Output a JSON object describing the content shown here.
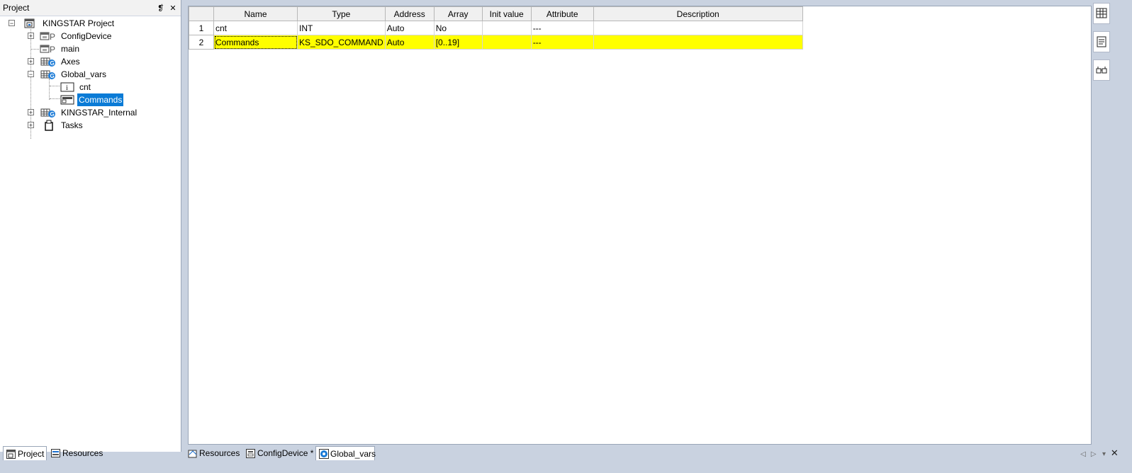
{
  "project_panel": {
    "title": "Project",
    "pin_glyph": "❡",
    "close_glyph": "✕",
    "tree": [
      {
        "label": "KINGSTAR Project",
        "icon": "project-icon",
        "expander": "−"
      },
      {
        "label": "ConfigDevice",
        "icon": "program-icon",
        "expander": "+"
      },
      {
        "label": "main",
        "icon": "program-icon",
        "expander": ""
      },
      {
        "label": "Axes",
        "icon": "global-vars-icon",
        "expander": "+"
      },
      {
        "label": "Global_vars",
        "icon": "global-vars-icon",
        "expander": "−"
      },
      {
        "label": "cnt",
        "icon": "int-var-icon",
        "expander": ""
      },
      {
        "label": "Commands",
        "icon": "struct-var-icon",
        "expander": ""
      },
      {
        "label": "KINGSTAR_Internal",
        "icon": "global-vars-icon",
        "expander": "+"
      },
      {
        "label": "Tasks",
        "icon": "tasks-icon",
        "expander": "+"
      }
    ]
  },
  "var_table": {
    "headers": [
      "Name",
      "Type",
      "Address",
      "Array",
      "Init value",
      "Attribute",
      "Description"
    ],
    "rows": [
      {
        "num": "1",
        "name": "cnt",
        "type": "INT",
        "address": "Auto",
        "array": "No",
        "init": "",
        "attribute": "---",
        "description": ""
      },
      {
        "num": "2",
        "name": "Commands",
        "type": "KS_SDO_COMMAND",
        "address": "Auto",
        "array": "[0..19]",
        "init": "",
        "attribute": "---",
        "description": ""
      }
    ]
  },
  "left_tabs": [
    "Project",
    "Resources"
  ],
  "doc_tabs": [
    "Resources",
    "ConfigDevice *",
    "Global_vars"
  ],
  "doc_nav": {
    "prev": "◁",
    "next": "▷",
    "menu": "▾",
    "close": "✕"
  },
  "colors": {
    "selection": "#0a7bd6",
    "row_highlight": "#ffff00",
    "frame_background": "#c9d2e0"
  }
}
